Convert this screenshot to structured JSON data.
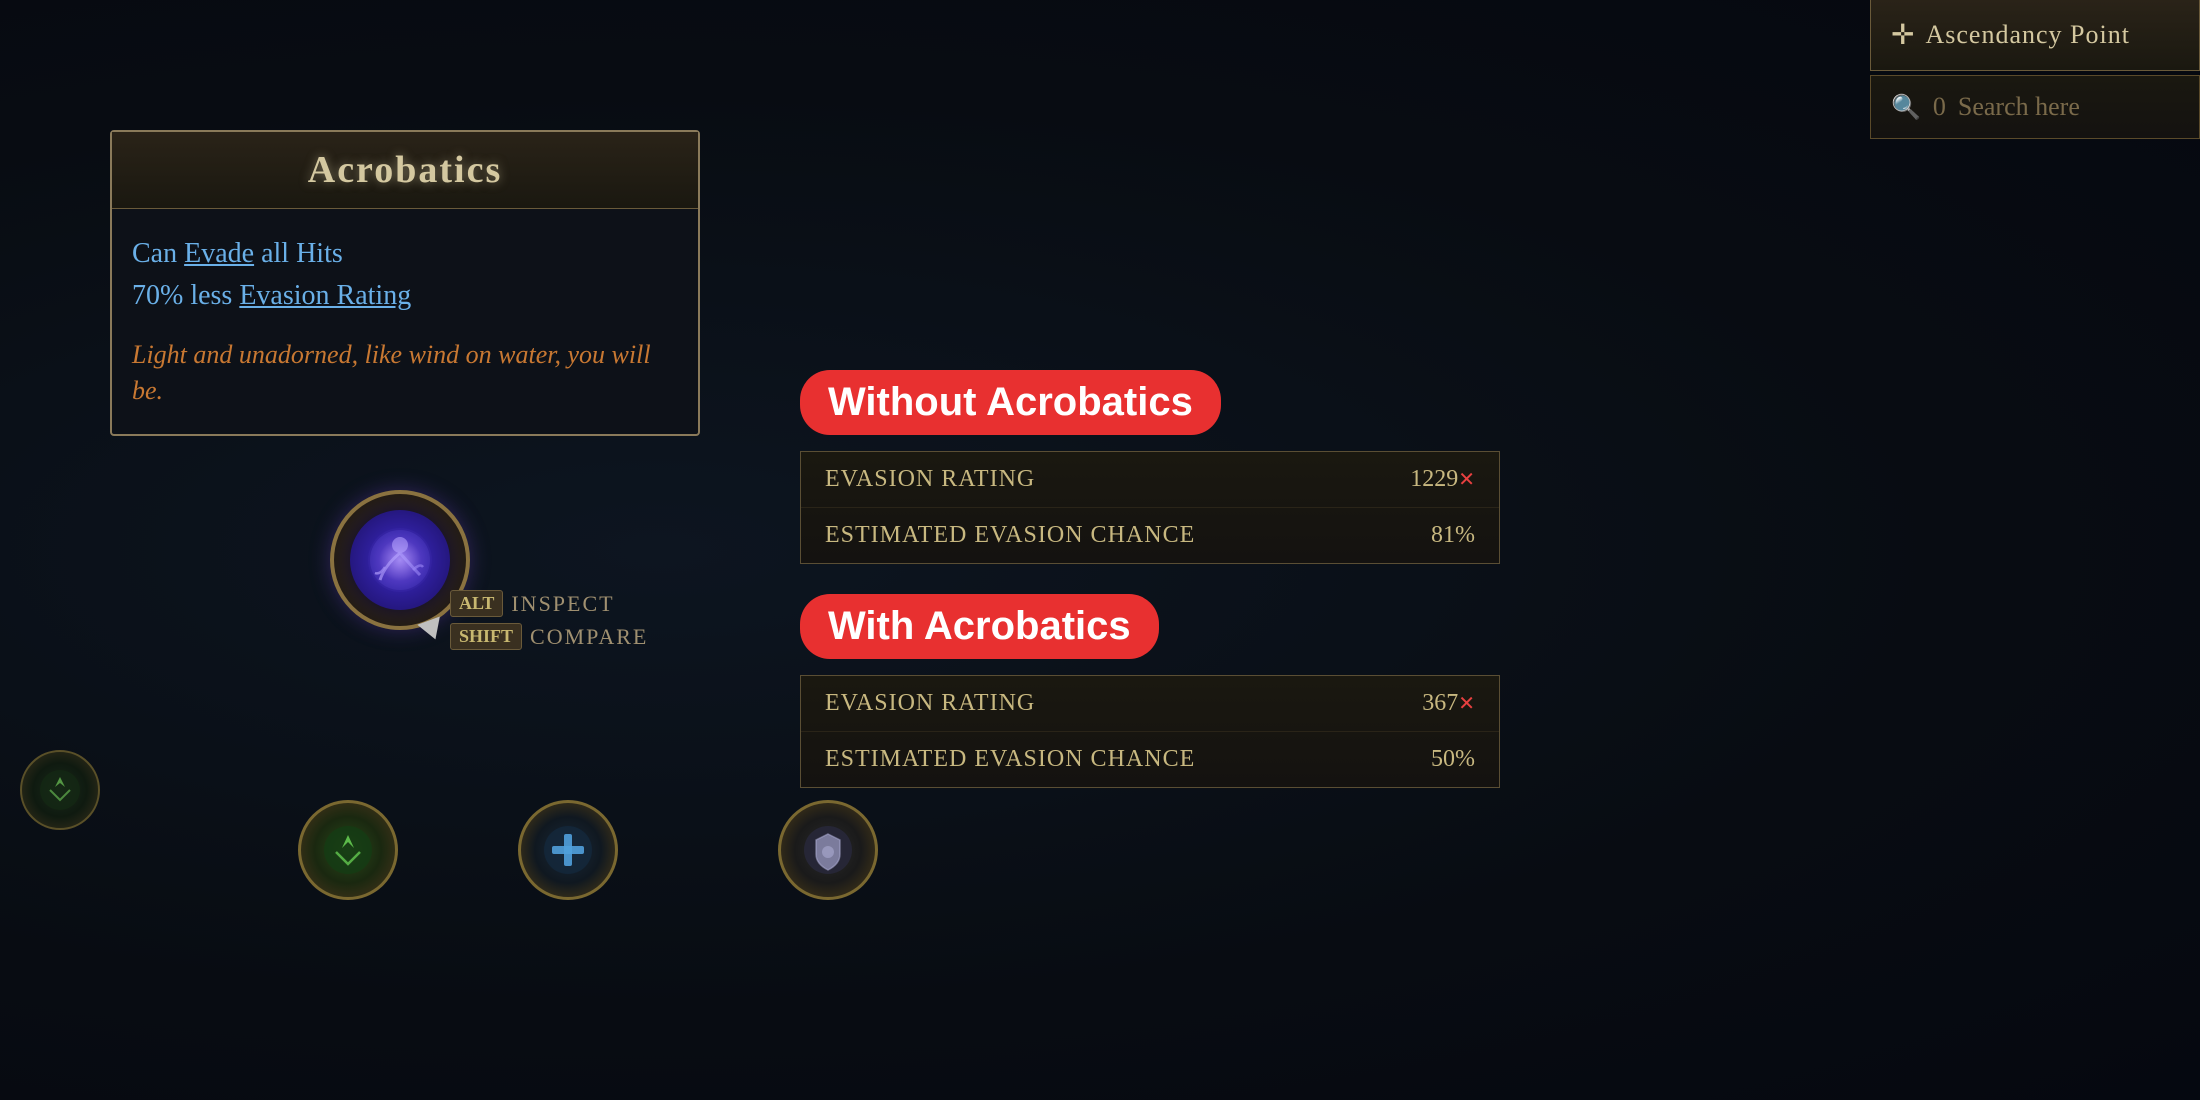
{
  "background": {
    "color": "#0a0e14"
  },
  "tooltip": {
    "title": "Acrobatics",
    "stat1_line1": "Can Evade all Hits",
    "stat1_line2": "70% less Evasion Rating",
    "flavor_text": "Light and unadorned, like wind on water, you will be.",
    "decorative_corner": "✦"
  },
  "context_menu": {
    "alt_key": "ALT",
    "inspect_label": "INSPECT",
    "shift_key": "SHIFT",
    "compare_label": "COMPARE"
  },
  "without_acrobatics": {
    "label": "Without Acrobatics",
    "evasion_rating_name": "Evasion Rating",
    "evasion_rating_value": "1229",
    "estimated_evasion_name": "Estimated Evasion Chance",
    "estimated_evasion_value": "81%"
  },
  "with_acrobatics": {
    "label": "With Acrobatics",
    "evasion_rating_name": "Evasion Rating",
    "evasion_rating_value": "367",
    "estimated_evasion_name": "Estimated Evasion Chance",
    "estimated_evasion_value": "50%"
  },
  "top_right": {
    "ascendancy_label": "Ascendancy Point",
    "search_count": "0",
    "search_placeholder": "Search here"
  },
  "icons": {
    "search": "🔍",
    "plus": "+",
    "acrobatics_node": "🌀"
  }
}
